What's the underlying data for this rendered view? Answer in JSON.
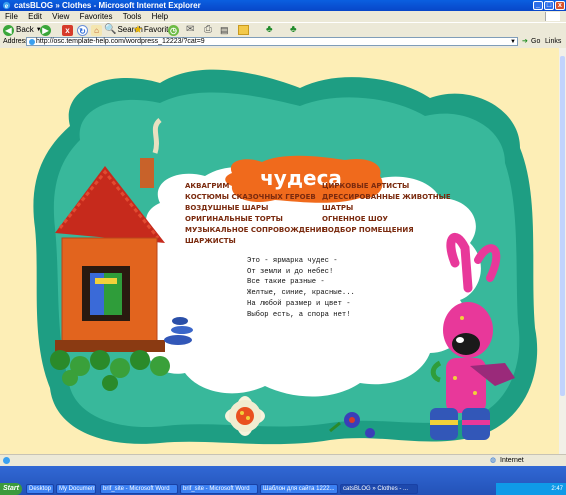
{
  "window": {
    "title": "catsBLOG » Clothes - Microsoft Internet Explorer",
    "controls": [
      "_",
      "□",
      "x"
    ]
  },
  "menu": [
    "File",
    "Edit",
    "View",
    "Favorites",
    "Tools",
    "Help"
  ],
  "toolbar": {
    "back_label": "Back",
    "search_label": "Search",
    "favorites_label": "Favorites"
  },
  "address": {
    "label": "Address",
    "url": "http://osc.template-help.com/wordpress_12223/?cat=9",
    "go_label": "Go",
    "links_label": "Links"
  },
  "page": {
    "heading": "чудеса",
    "links_left": [
      "аквагрим",
      "костюмы сказочных героев",
      "воздушные шары",
      "оригинальные торты",
      "музыкальное сопровождение",
      "шаржисты"
    ],
    "links_right": [
      "цирковые артисты",
      "дрессированные животные",
      "шатры",
      "огненное шоу",
      "подбор помещения"
    ],
    "poem": [
      "Это - ярмарка чудес -",
      "От земли и до небес!",
      "Все такие разные -",
      "Желтые, синие, красные...",
      "На любой размер и цвет -",
      "Выбор есть, а спора нет!"
    ]
  },
  "status": {
    "zone": "Internet"
  },
  "taskbar": {
    "start_label": "Start",
    "items": [
      "Desktop",
      "My Documents",
      "brif_site - Microsoft Word",
      "brif_site - Microsoft Word",
      "Шаблон для сайта 1222...",
      "catsBLOG » Clothes - ..."
    ],
    "clock": "2:47"
  },
  "colors": {
    "page_bg": "#fdeeb6",
    "frame_green": "#1e9e83",
    "badge_orange": "#f06a1c",
    "link_brown": "#7a2a0e"
  }
}
